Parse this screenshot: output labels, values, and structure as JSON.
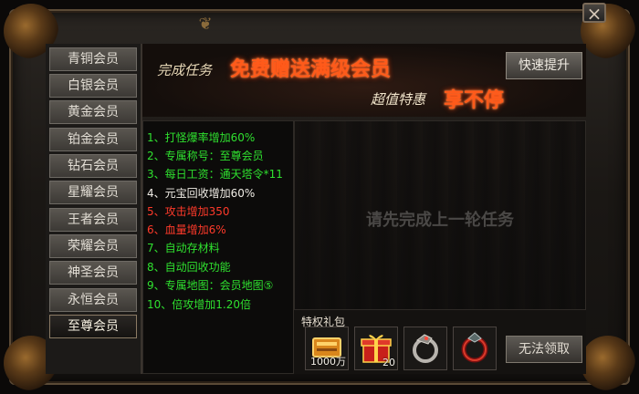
{
  "window": {
    "close_label": "×"
  },
  "sidebar": {
    "items": [
      {
        "label": "青铜会员"
      },
      {
        "label": "白银会员"
      },
      {
        "label": "黄金会员"
      },
      {
        "label": "铂金会员"
      },
      {
        "label": "钻石会员"
      },
      {
        "label": "星耀会员"
      },
      {
        "label": "王者会员"
      },
      {
        "label": "荣耀会员"
      },
      {
        "label": "神圣会员"
      },
      {
        "label": "永恒会员"
      },
      {
        "label": "至尊会员"
      }
    ],
    "active": "至尊会员"
  },
  "banner": {
    "pre": "完成任务",
    "main": "免费赠送满级会员",
    "sub": "超值特惠",
    "sub_highlight": "享不停",
    "quick_button": "快速提升"
  },
  "perks": [
    {
      "text": "1、打怪爆率增加60%",
      "color": "#2fe02f"
    },
    {
      "text": "2、专属称号：至尊会员",
      "color": "#2fe02f"
    },
    {
      "text": "3、每日工资：通天塔令*11",
      "color": "#2fe02f"
    },
    {
      "text": "4、元宝回收增加60%",
      "color": "#f0ede6"
    },
    {
      "text": "5、攻击增加350",
      "color": "#ff3a2a"
    },
    {
      "text": "6、血量增加6%",
      "color": "#ff3a2a"
    },
    {
      "text": "7、自动存材料",
      "color": "#2fe02f"
    },
    {
      "text": "8、自动回收功能",
      "color": "#2fe02f"
    },
    {
      "text": "9、专属地图：会员地图⑤",
      "color": "#2fe02f"
    },
    {
      "text": "10、倍攻增加1.20倍",
      "color": "#2fe02f"
    }
  ],
  "task": {
    "message": "请先完成上一轮任务"
  },
  "gift": {
    "title": "特权礼包",
    "items": [
      {
        "icon": "gold-ingot-icon",
        "qty": "1000万"
      },
      {
        "icon": "gift-box-icon",
        "qty": "20"
      },
      {
        "icon": "dragon-ring-icon",
        "qty": ""
      },
      {
        "icon": "red-ring-icon",
        "qty": ""
      }
    ],
    "claim_button": "无法领取"
  },
  "colors": {
    "accent_orange": "#ff5a1a",
    "perk_green": "#2fe02f",
    "perk_red": "#ff3a2a"
  }
}
